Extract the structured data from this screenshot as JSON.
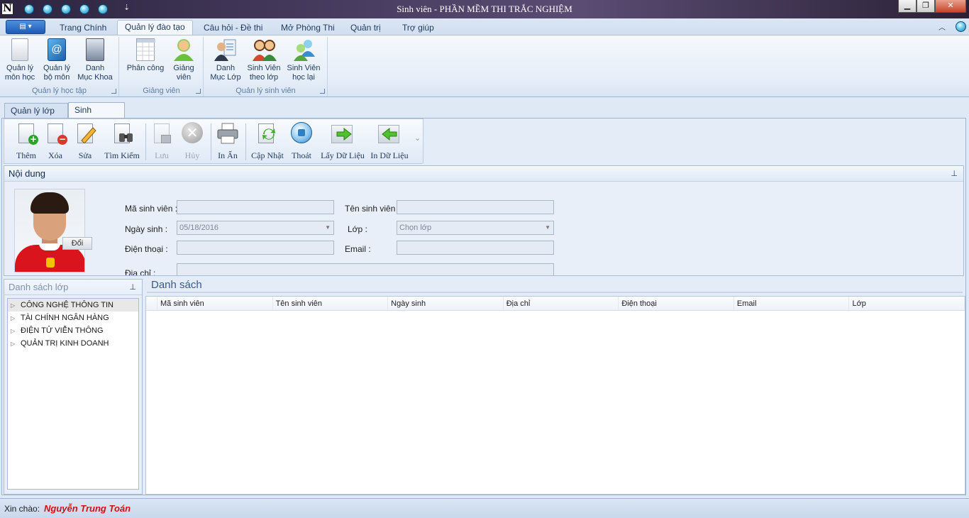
{
  "window": {
    "title": "Sinh viên - PHẦN MỀM THI TRẮC NGHIỆM",
    "app_icon": "N",
    "qat_more": "⇣"
  },
  "ribbon": {
    "app_menu_icon": "▤ ▾",
    "tabs": [
      {
        "label": "Trang Chính"
      },
      {
        "label": "Quản lý đào tạo"
      },
      {
        "label": "Câu hỏi - Đề thi"
      },
      {
        "label": "Mở Phòng Thi"
      },
      {
        "label": "Quản trị"
      },
      {
        "label": "Trợ giúp"
      }
    ],
    "active_tab": "Quản lý đào tạo",
    "groups": [
      {
        "label": "Quản lý học tập",
        "buttons": [
          {
            "label": "Quản lý\nmôn học",
            "icon": "document-icon"
          },
          {
            "label": "Quản lý\nbộ môn",
            "icon": "address-book-icon"
          },
          {
            "label": "Danh\nMục Khoa",
            "icon": "server-icon"
          }
        ]
      },
      {
        "label": "Giảng viên",
        "buttons": [
          {
            "label": "Phân công",
            "icon": "calendar-icon"
          },
          {
            "label": "Giảng\nviên",
            "icon": "teacher-icon"
          }
        ]
      },
      {
        "label": "Quản lý sinh viên",
        "buttons": [
          {
            "label": "Danh\nMục Lớp",
            "icon": "class-list-icon"
          },
          {
            "label": "Sinh Viên\ntheo lớp",
            "icon": "students-icon"
          },
          {
            "label": "Sinh Viên\nhọc lại",
            "icon": "retake-students-icon"
          }
        ]
      }
    ]
  },
  "doc_tabs": [
    {
      "label": "Quản lý lớp"
    },
    {
      "label": "Sinh viên",
      "close": "✕"
    }
  ],
  "toolbar": {
    "buttons": [
      {
        "label": "Thêm",
        "icon": "add-icon",
        "enabled": true
      },
      {
        "label": "Xóa",
        "icon": "delete-icon",
        "enabled": true
      },
      {
        "label": "Sửa",
        "icon": "edit-icon",
        "enabled": true
      },
      {
        "label": "Tìm Kiếm",
        "icon": "search-icon",
        "enabled": true
      },
      {
        "label": "Lưu",
        "icon": "save-icon",
        "enabled": false
      },
      {
        "label": "Hủy",
        "icon": "cancel-icon",
        "enabled": false
      },
      {
        "label": "In Ấn",
        "icon": "printer-icon",
        "enabled": true
      },
      {
        "label": "Cập Nhật",
        "icon": "refresh-icon",
        "enabled": true
      },
      {
        "label": "Thoát",
        "icon": "exit-icon",
        "enabled": true
      },
      {
        "label": "Lấy Dữ Liệu",
        "icon": "import-icon",
        "enabled": true
      },
      {
        "label": "In Dữ Liệu",
        "icon": "export-icon",
        "enabled": true
      }
    ],
    "more": "⌄"
  },
  "noidung": {
    "title": "Nội dung",
    "pin": "⊥",
    "change_photo_label": "Đổi",
    "fields": {
      "ma_sv_label": "Mã sinh viên :",
      "ma_sv_value": "",
      "ten_sv_label": "Tên sinh viên :",
      "ten_sv_value": "",
      "ngay_sinh_label": "Ngày sinh :",
      "ngay_sinh_value": "05/18/2016",
      "lop_label": "Lớp :",
      "lop_value": "Chọn lớp",
      "dien_thoai_label": "Điện thoại :",
      "dien_thoai_value": "",
      "email_label": "Email :",
      "email_value": "",
      "dia_chi_label": "Địa chỉ :",
      "dia_chi_value": ""
    }
  },
  "danh_sach_lop": {
    "title": "Danh sách lớp",
    "pin": "⊥",
    "items": [
      {
        "label": "CÔNG NGHỆ THÔNG TIN"
      },
      {
        "label": "TÀI CHÍNH NGÂN HÀNG"
      },
      {
        "label": "ĐIỆN TỬ VIỄN THÔNG"
      },
      {
        "label": "QUẢN TRỊ KINH DOANH"
      }
    ],
    "selected": "CÔNG NGHỆ THÔNG TIN"
  },
  "danh_sach": {
    "title": "Danh sách",
    "columns": [
      "Mã sinh viên",
      "Tên sinh viên",
      "Ngày sinh",
      "Địa chỉ",
      "Điện thoại",
      "Email",
      "Lớp"
    ],
    "rows": []
  },
  "status": {
    "greeting": "Xin chào:",
    "user_name": "Nguyễn Trung Toán"
  },
  "colors": {
    "accent": "#1f5bb6",
    "user_name": "#d11111",
    "ribbon_bg": "#dfe8f5"
  }
}
